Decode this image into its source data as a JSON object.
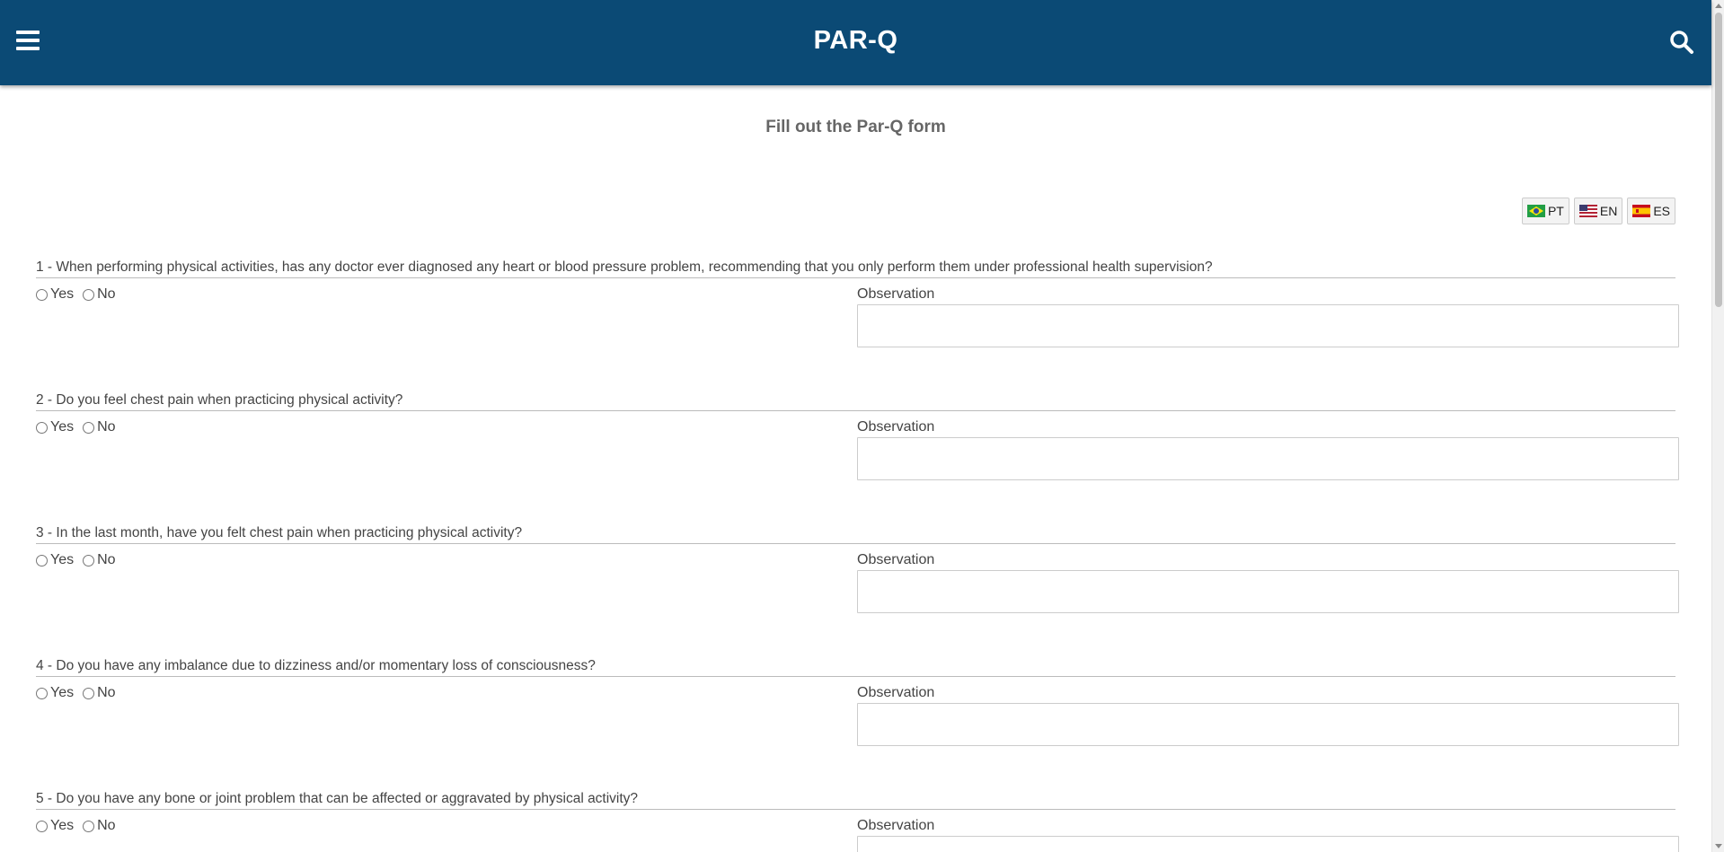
{
  "header": {
    "title": "PAR-Q",
    "menu_icon": "hamburger-menu-icon",
    "search_icon": "search-icon",
    "background_color": "#0b4a75"
  },
  "page": {
    "subtitle": "Fill out the Par-Q form"
  },
  "languages": [
    {
      "code": "PT",
      "flag": "brazil-flag-icon"
    },
    {
      "code": "EN",
      "flag": "usa-flag-icon"
    },
    {
      "code": "ES",
      "flag": "spain-flag-icon"
    }
  ],
  "form": {
    "yes_label": "Yes",
    "no_label": "No",
    "observation_label": "Observation",
    "questions": [
      {
        "text": "1 - When performing physical activities, has any doctor ever diagnosed any heart or blood pressure problem, recommending that you only perform them under professional health supervision?",
        "observation": ""
      },
      {
        "text": "2 - Do you feel chest pain when practicing physical activity?",
        "observation": ""
      },
      {
        "text": "3 - In the last month, have you felt chest pain when practicing physical activity?",
        "observation": ""
      },
      {
        "text": "4 - Do you have any imbalance due to dizziness and/or momentary loss of consciousness?",
        "observation": ""
      },
      {
        "text": "5 - Do you have any bone or joint problem that can be affected or aggravated by physical activity?",
        "observation": ""
      }
    ]
  }
}
